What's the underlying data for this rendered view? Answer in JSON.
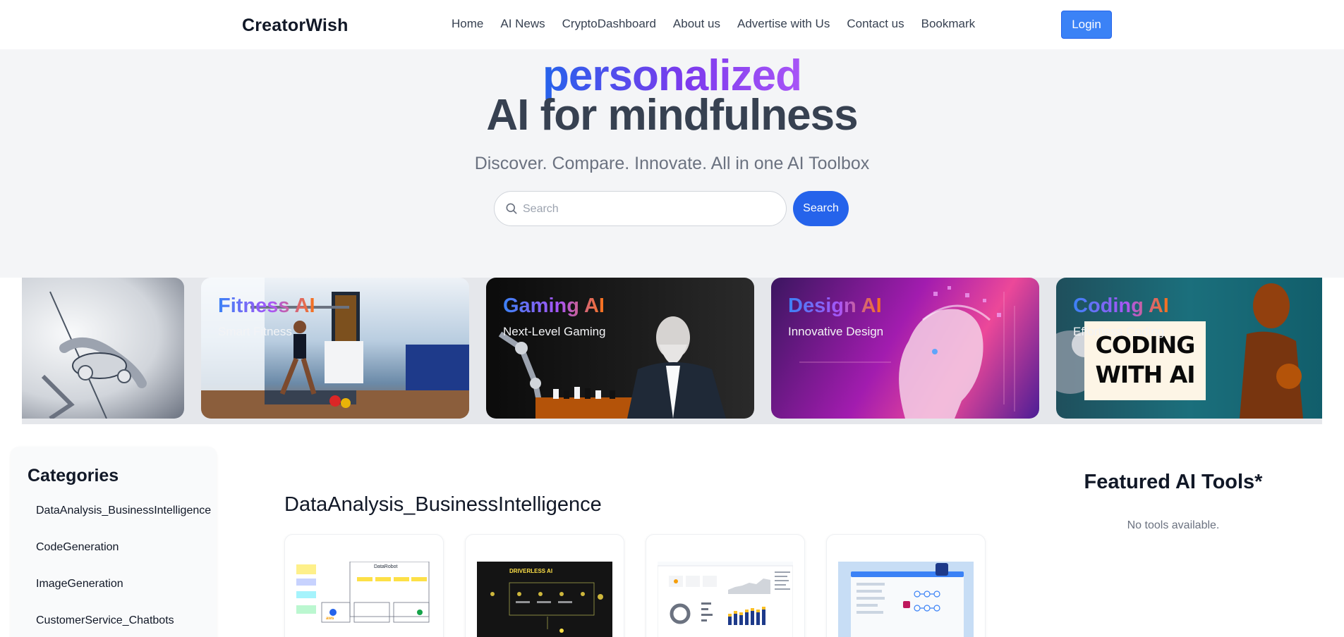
{
  "nav": {
    "brand": "CreatorWish",
    "items": [
      "Home",
      "AI News",
      "CryptoDashboard",
      "About us",
      "Advertise with Us",
      "Contact us",
      "Bookmark"
    ],
    "login": "Login"
  },
  "hero": {
    "highlight": "personalized",
    "title": "AI for mindfulness",
    "subtitle": "Discover. Compare. Innovate. All in one AI Toolbox",
    "search_placeholder": "Search",
    "search_button": "Search"
  },
  "carousel": [
    {
      "title": "",
      "subtitle": ""
    },
    {
      "title": "Fitness AI",
      "subtitle": "Smart Fitness"
    },
    {
      "title": "Gaming AI",
      "subtitle": "Next-Level Gaming"
    },
    {
      "title": "Design AI",
      "subtitle": "Innovative Design"
    },
    {
      "title": "Coding AI",
      "subtitle": "Effortless Coding",
      "sign_text": "CODING WITH AI"
    }
  ],
  "sidebar": {
    "title": "Categories",
    "items": [
      "DataAnalysis_BusinessIntelligence",
      "CodeGeneration",
      "ImageGeneration",
      "CustomerService_Chatbots"
    ]
  },
  "main": {
    "section_title": "DataAnalysis_BusinessIntelligence",
    "card_titles": [
      "DataRobot",
      "DRIVERLESS AI"
    ]
  },
  "featured": {
    "title": "Featured AI Tools*",
    "empty_text": "No tools available."
  },
  "colors": {
    "primary": "#2563eb",
    "login": "#3b82f6",
    "hero_bg": "#f4f5f7",
    "gradient_start": "#2563eb",
    "gradient_end": "#a855f7"
  }
}
